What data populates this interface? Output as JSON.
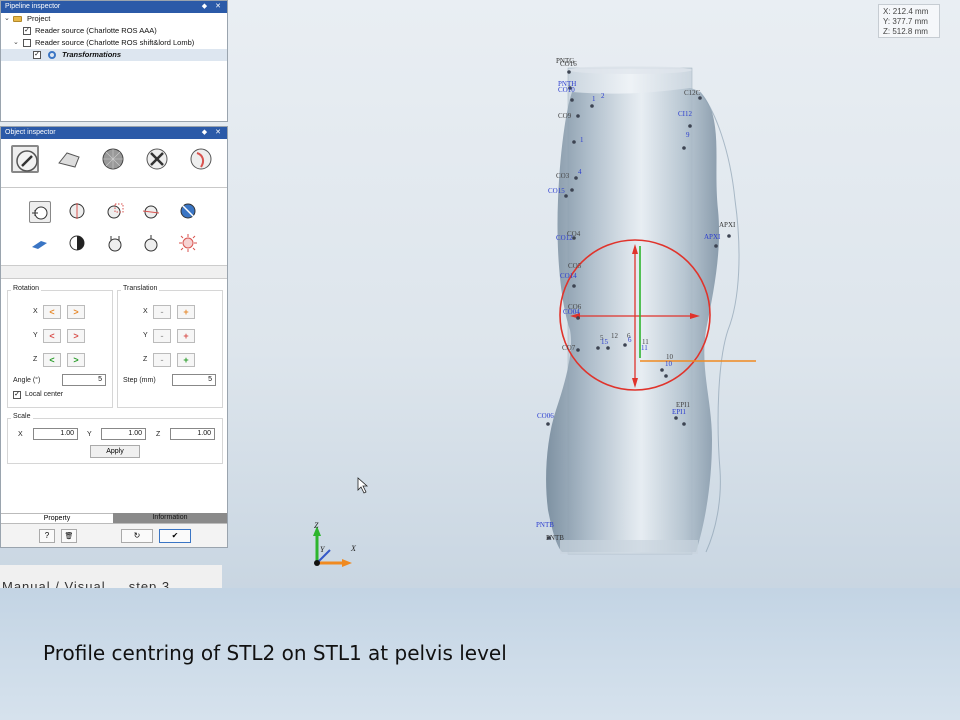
{
  "coordinates": {
    "x": "X: 212.4 mm",
    "y": "Y: 377.7 mm",
    "z": "Z: 512.8 mm"
  },
  "pipeline": {
    "title": "Pipeline inspector",
    "items": [
      {
        "label": "Project"
      },
      {
        "label": "Reader source (Charlotte ROS AAA)",
        "checked": true
      },
      {
        "label": "Reader source (Charlotte ROS shift&lord Lomb)",
        "checked": false
      },
      {
        "label": "Transformations",
        "checked": true
      }
    ]
  },
  "object_inspector": {
    "title": "Object inspector",
    "rotation": {
      "title": "Rotation",
      "angle_label": "Angle (°)",
      "angle_value": "5",
      "local_center_label": "Local center",
      "local_center_checked": true
    },
    "translation": {
      "title": "Translation",
      "step_label": "Step (mm)",
      "step_value": "5"
    },
    "axes": [
      "X",
      "Y",
      "Z"
    ],
    "buttons": {
      "minus": "<",
      "plus": ">",
      "tminus": "-",
      "tplus": "+"
    },
    "scale": {
      "title": "Scale",
      "x": "1.00",
      "y": "1.00",
      "z": "1.00",
      "apply": "Apply"
    },
    "tabs": {
      "property": "Property",
      "information": "Information"
    },
    "bottom": {
      "help": "?",
      "trash": "🗑",
      "reset": "↻",
      "ok": "✔"
    }
  },
  "axis_triad": {
    "z": "Z",
    "y": "Y",
    "x": "X"
  },
  "landmarks": {
    "top": "PNTG",
    "top2": "CO16",
    "pnth": "PNTH",
    "c010": "CO10",
    "l1": "1",
    "l2": "2",
    "c9": "CO9",
    "c4": "4",
    "c03": "CO3",
    "co15": "CO15",
    "c04": "CO4",
    "co12": "CO12",
    "co14": "CO14",
    "c5": "CO5",
    "co16b": "CO16",
    "co6": "CO6",
    "co04": "CO04",
    "co7": "CO7",
    "m5": "5",
    "m12": "12",
    "m6": "6",
    "m11": "11",
    "m15": "15",
    "m11b": "11",
    "m10": "10",
    "m10b": "10",
    "co06": "CO06",
    "pntb": "PNTB",
    "pntb2": "PNTB",
    "c12c": "C12C",
    "ci12": "CI12",
    "r9": "9",
    "apxi": "APXI",
    "apxi2": "APXI",
    "epi1": "EPI1",
    "epi2": "EPI1"
  },
  "caption_strip": "Manual / Visual ... step 3 ...",
  "caption": "Profile centring of STL2 on STL1 at pelvis level",
  "colors": {
    "header": "#2b5aa8",
    "circle": "#e0332b",
    "landmark_blue": "#2a3ccf",
    "green_axis": "#2db52d",
    "orange_axis": "#f08a20"
  }
}
